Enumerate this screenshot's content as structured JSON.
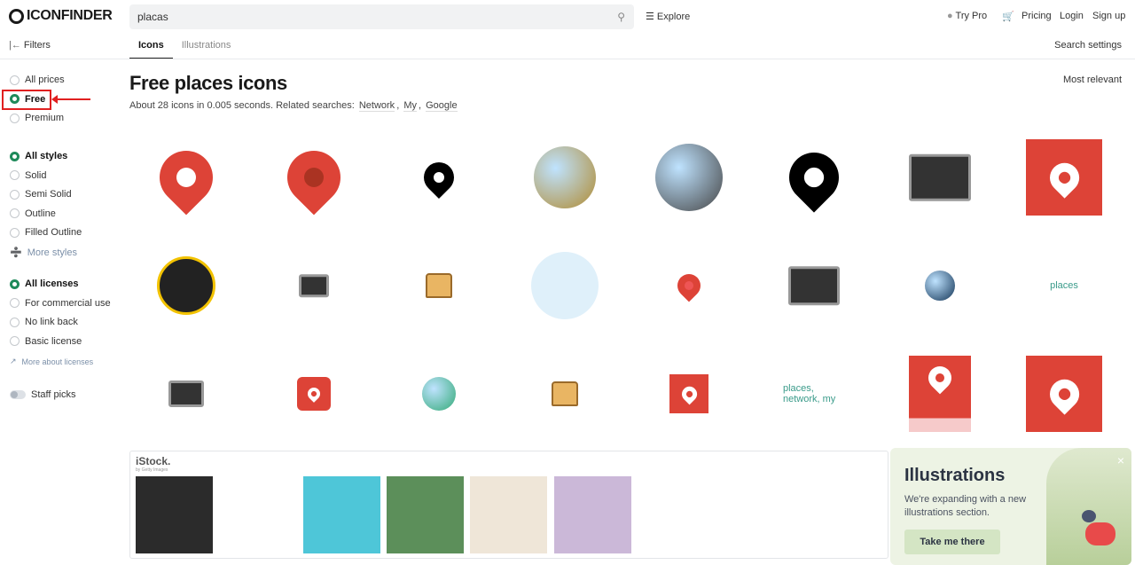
{
  "header": {
    "logo": "ICONFINDER",
    "search_value": "placas",
    "explore": "Explore",
    "try_pro": "Try Pro",
    "pricing": "Pricing",
    "login": "Login",
    "signup": "Sign up"
  },
  "subheader": {
    "filters": "Filters",
    "tabs": [
      "Icons",
      "Illustrations"
    ],
    "search_settings": "Search settings"
  },
  "sidebar": {
    "prices": [
      {
        "label": "All prices",
        "selected": false
      },
      {
        "label": "Free",
        "selected": true
      },
      {
        "label": "Premium",
        "selected": false
      }
    ],
    "styles": [
      {
        "label": "All styles",
        "selected": true
      },
      {
        "label": "Solid",
        "selected": false
      },
      {
        "label": "Semi Solid",
        "selected": false
      },
      {
        "label": "Outline",
        "selected": false
      },
      {
        "label": "Filled Outline",
        "selected": false
      }
    ],
    "more_styles": "More styles",
    "licenses": [
      {
        "label": "All licenses",
        "selected": true
      },
      {
        "label": "For commercial use",
        "selected": false
      },
      {
        "label": "No link back",
        "selected": false
      },
      {
        "label": "Basic license",
        "selected": false
      }
    ],
    "more_licenses": "More about licenses",
    "staff_picks": "Staff picks"
  },
  "main": {
    "title": "Free places icons",
    "meta": "About 28 icons in 0.005 seconds. Related searches:",
    "related": [
      "Network",
      "My",
      "Google"
    ],
    "sort": "Most relevant",
    "broken_alt_1": "places",
    "broken_alt_2": "places, network, my"
  },
  "istock": {
    "brand": "iStock.",
    "sub": "by Getty Images"
  },
  "promo": {
    "title": "Illustrations",
    "text": "We're expanding with a new illustrations section.",
    "button": "Take me there"
  },
  "colors": {
    "accent": "#1e8a5a",
    "red": "#dd4337"
  }
}
